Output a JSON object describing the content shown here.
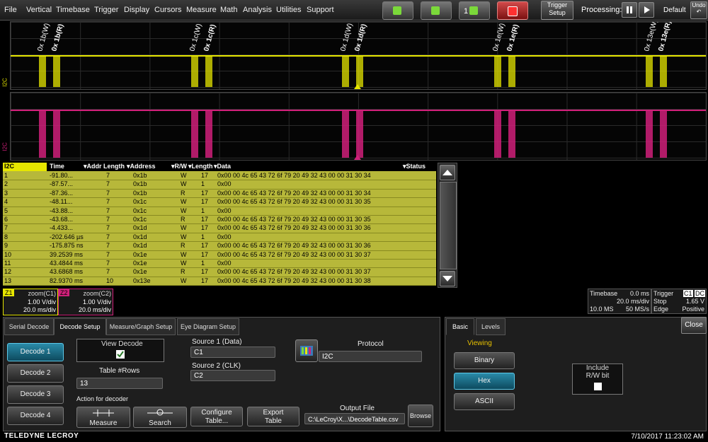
{
  "menu": [
    "File",
    "Vertical",
    "Timebase",
    "Trigger",
    "Display",
    "Cursors",
    "Measure",
    "Math",
    "Analysis",
    "Utilities",
    "Support"
  ],
  "toolbar": {
    "trigger_setup_1": "Trigger",
    "trigger_setup_2": "Setup",
    "processing": "Processing:",
    "default": "Default",
    "undo": "Undo",
    "count_label": "1"
  },
  "trace1": {
    "label": "I2C",
    "annotations": [
      "0x 1b(W)",
      "0x 1b(R)",
      "0x 1c(W)",
      "0x 1c(R)",
      "0x 1d(W)",
      "0x 1d(R)",
      "0x 1e(W)",
      "0x 1e(R)",
      "0x 13e(W)",
      "0x 13e(R)"
    ],
    "color": "#e6e600"
  },
  "trace2": {
    "label": "I2C",
    "color": "#d0207a"
  },
  "table": {
    "title": "I2C",
    "headers": [
      "Time",
      "Addr Length",
      "Address",
      "R/W",
      "Length",
      "Data",
      "Status"
    ],
    "rows": [
      [
        "1",
        "-91.80...",
        "7",
        "0x1b",
        "W",
        "17",
        "0x00 00 4c 65 43 72 6f 79 20 49 32 43 00 00 31 30 34"
      ],
      [
        "2",
        "-87.57...",
        "7",
        "0x1b",
        "W",
        "1",
        "0x00"
      ],
      [
        "3",
        "-87.36...",
        "7",
        "0x1b",
        "R",
        "17",
        "0x00 00 4c 65 43 72 6f 79 20 49 32 43 00 00 31 30 34"
      ],
      [
        "4",
        "-48.11...",
        "7",
        "0x1c",
        "W",
        "17",
        "0x00 00 4c 65 43 72 6f 79 20 49 32 43 00 00 31 30 35"
      ],
      [
        "5",
        "-43.88...",
        "7",
        "0x1c",
        "W",
        "1",
        "0x00"
      ],
      [
        "6",
        "-43.68...",
        "7",
        "0x1c",
        "R",
        "17",
        "0x00 00 4c 65 43 72 6f 79 20 49 32 43 00 00 31 30 35"
      ],
      [
        "7",
        "-4.433...",
        "7",
        "0x1d",
        "W",
        "17",
        "0x00 00 4c 65 43 72 6f 79 20 49 32 43 00 00 31 30 36"
      ],
      [
        "8",
        "-202.646 µs",
        "7",
        "0x1d",
        "W",
        "1",
        "0x00"
      ],
      [
        "9",
        "-175.875 ns",
        "7",
        "0x1d",
        "R",
        "17",
        "0x00 00 4c 65 43 72 6f 79 20 49 32 43 00 00 31 30 36"
      ],
      [
        "10",
        "39.2539 ms",
        "7",
        "0x1e",
        "W",
        "17",
        "0x00 00 4c 65 43 72 6f 79 20 49 32 43 00 00 31 30 37"
      ],
      [
        "11",
        "43.4844 ms",
        "7",
        "0x1e",
        "W",
        "1",
        "0x00"
      ],
      [
        "12",
        "43.6868 ms",
        "7",
        "0x1e",
        "R",
        "17",
        "0x00 00 4c 65 43 72 6f 79 20 49 32 43 00 00 31 30 37"
      ],
      [
        "13",
        "82.9370 ms",
        "10",
        "0x13e",
        "W",
        "17",
        "0x00 00 4c 65 43 72 6f 79 20 49 32 43 00 00 31 30 38"
      ]
    ]
  },
  "zoom1": {
    "tag": "Z1",
    "name": "zoom(C1)",
    "vdiv": "1.00 V/div",
    "tdiv": "20.0 ms/div"
  },
  "zoom2": {
    "tag": "Z2",
    "name": "zoom(C2)",
    "vdiv": "1.00 V/div",
    "tdiv": "20.0 ms/div"
  },
  "timebase": {
    "label": "Timebase",
    "offset": "0.0 ms",
    "tdiv": "20.0 ms/div",
    "samples": "10.0 MS",
    "rate": "50 MS/s"
  },
  "trigger": {
    "label": "Trigger",
    "src1": "C1",
    "src2": "DC",
    "mode": "Stop",
    "level": "1.65 V",
    "type": "Edge",
    "slope": "Positive"
  },
  "tabs": [
    "Serial Decode",
    "Decode Setup",
    "Measure/Graph Setup",
    "Eye Diagram Setup"
  ],
  "decodes": [
    "Decode 1",
    "Decode 2",
    "Decode 3",
    "Decode 4"
  ],
  "setup": {
    "view_decode": "View Decode",
    "table_rows_label": "Table #Rows",
    "table_rows": "13",
    "action_label": "Action for decoder",
    "measure": "Measure",
    "search": "Search",
    "configure_1": "Configure",
    "configure_2": "Table...",
    "export_1": "Export",
    "export_2": "Table",
    "source1_label": "Source 1 (Data)",
    "source1": "C1",
    "source2_label": "Source 2 (CLK)",
    "source2": "C2",
    "protocol_label": "Protocol",
    "protocol": "I2C",
    "output_label": "Output File",
    "output_file": "C:\\LeCroy\\X...\\DecodeTable.csv",
    "browse": "Browse"
  },
  "right_panel": {
    "tabs": [
      "Basic",
      "Levels"
    ],
    "close": "Close",
    "viewing": "Viewing",
    "buttons": [
      "Binary",
      "Hex",
      "ASCII"
    ],
    "include_1": "Include",
    "include_2": "R/W bit"
  },
  "footer": {
    "brand": "TELEDYNE LECROY",
    "datetime": "7/10/2017 11:23:02 AM"
  }
}
